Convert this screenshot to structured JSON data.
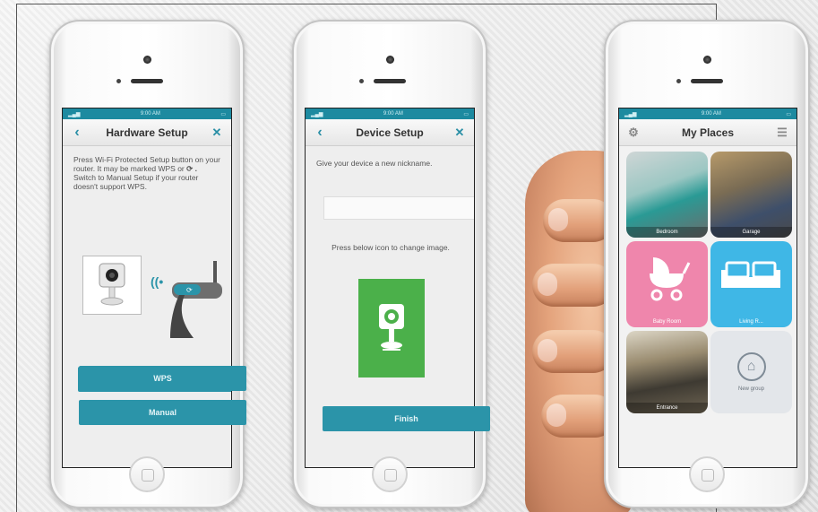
{
  "status_time": "9:00 AM",
  "screens": {
    "hardware_setup": {
      "title": "Hardware Setup",
      "instruction": "Press Wi-Fi Protected Setup button on your router. It may be marked WPS or",
      "instruction_2": "Switch to Manual Setup if your router doesn't support WPS.",
      "wps_button": "WPS",
      "manual_button": "Manual"
    },
    "device_setup": {
      "title": "Device Setup",
      "nickname_prompt": "Give your device a new nickname.",
      "nickname_value": "",
      "image_prompt": "Press below icon to change image.",
      "finish_button": "Finish"
    },
    "my_places": {
      "title": "My Places",
      "tiles": [
        {
          "label": "Bedroom"
        },
        {
          "label": "Garage"
        },
        {
          "label": "Baby Room"
        },
        {
          "label": "Living R..."
        },
        {
          "label": "Entrance"
        },
        {
          "label": "New group"
        }
      ]
    }
  },
  "colors": {
    "accent": "#2b94a9",
    "status_bar": "#1d8aa0",
    "camera_tile": "#4bb04a",
    "baby_tile": "#ef86ac",
    "living_tile": "#3fb7e6"
  }
}
